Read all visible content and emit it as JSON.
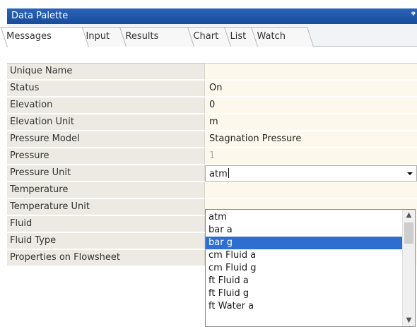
{
  "palette": {
    "title": "Data Palette",
    "pin_glyph": "ᵠ",
    "tabs": [
      {
        "label": "Messages"
      },
      {
        "label": "Input"
      },
      {
        "label": "Results"
      },
      {
        "label": "Chart"
      },
      {
        "label": "List"
      },
      {
        "label": "Watch"
      }
    ],
    "properties": [
      {
        "label": "Unique Name",
        "value": ""
      },
      {
        "label": "Status",
        "value": "On"
      },
      {
        "label": "Elevation",
        "value": "0"
      },
      {
        "label": "Elevation Unit",
        "value": "m"
      },
      {
        "label": "Pressure Model",
        "value": "Stagnation Pressure"
      },
      {
        "label": "Pressure",
        "value": "1"
      },
      {
        "label": "Pressure Unit",
        "value": "atm"
      },
      {
        "label": "Temperature",
        "value": ""
      },
      {
        "label": "Temperature Unit",
        "value": ""
      },
      {
        "label": "Fluid",
        "value": ""
      },
      {
        "label": "Fluid Type",
        "value": ""
      },
      {
        "label": "Properties on Flowsheet",
        "value": ""
      }
    ],
    "dropdown": {
      "selected": "bar g",
      "options": [
        "atm",
        "bar a",
        "bar g",
        "cm Fluid a",
        "cm Fluid g",
        "ft Fluid a",
        "ft Fluid g",
        "ft Water a"
      ]
    },
    "colors": {
      "title_bar": "#1f57a8",
      "selection": "#2f6ed1",
      "label_cell": "#eceae3",
      "value_cell": "#fcf9ec"
    },
    "icons": [
      "pin-icon",
      "dropdown-arrow-icon",
      "scroll-up-icon",
      "scroll-down-icon"
    ]
  }
}
